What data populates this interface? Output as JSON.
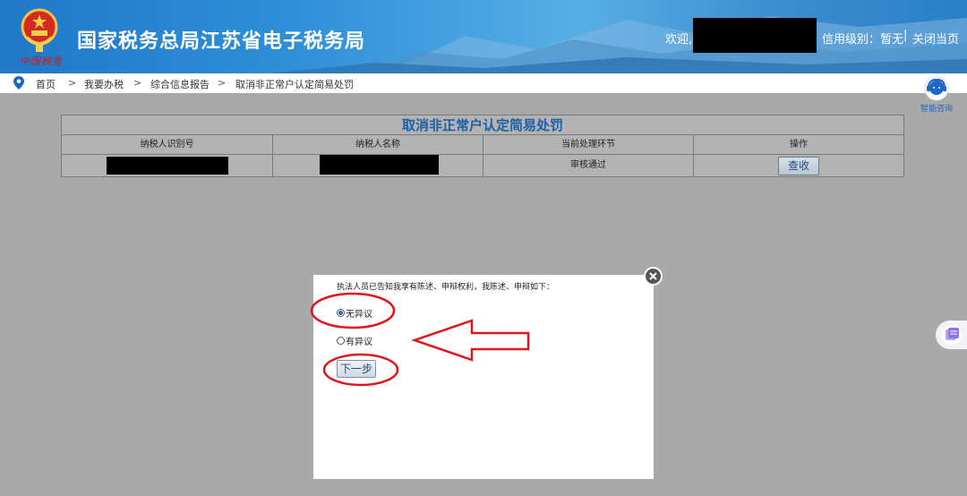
{
  "header": {
    "site_title": "国家税务总局江苏省电子税务局",
    "calligraphy": "中国税务",
    "welcome": "欢迎,",
    "credit_level": "信用级别：暂无",
    "separator": "|",
    "close_page": "关闭当页"
  },
  "breadcrumb": {
    "items": [
      "首页",
      "我要办税",
      "综合信息报告",
      "取消非正常户认定简易处罚"
    ],
    "arrow": ">"
  },
  "side": {
    "consult_label": "智能咨询"
  },
  "table": {
    "title": "取消非正常户认定简易处罚",
    "headers": [
      "纳税人识别号",
      "纳税人名称",
      "当前处理环节",
      "操作"
    ],
    "row": {
      "stage": "审核通过",
      "action": "查收"
    }
  },
  "modal": {
    "prompt": "执法人员已告知我享有陈述、申辩权利，我陈述、申辩如下：",
    "options": [
      {
        "label": "无异议",
        "checked": true
      },
      {
        "label": "有异议",
        "checked": false
      }
    ],
    "next_label": "下一步"
  },
  "colors": {
    "header_blue": "#2e8fd8",
    "overlay_gray": "#a9a9a9",
    "annotation_red": "#e0141c",
    "title_blue": "#1d5fa8"
  }
}
